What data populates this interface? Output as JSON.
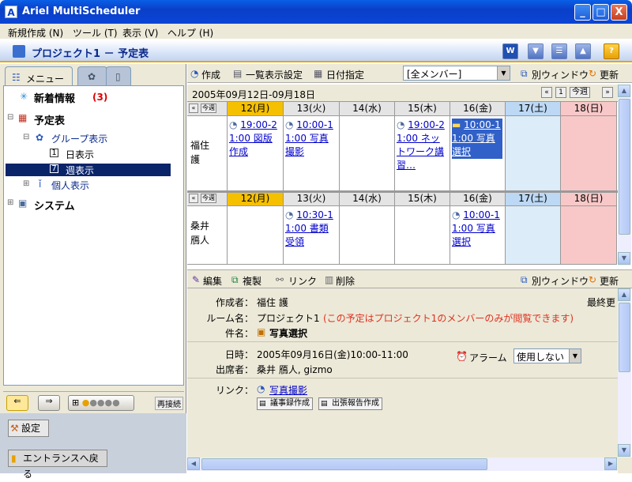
{
  "window": {
    "title": "Ariel MultiScheduler",
    "app_icon": "A",
    "minimize": "_",
    "maximize": "□",
    "close": "X"
  },
  "menu": [
    "新規作成 (N)",
    "ツール (T)",
    "表示 (V)",
    "ヘルプ (H)"
  ],
  "project": {
    "title": "プロジェクト1 － 予定表"
  },
  "left": {
    "tab_menu": "メニュー",
    "tree": {
      "news": "新着情報",
      "news_count": "(3)",
      "schedule": "予定表",
      "group_view": "グループ表示",
      "day_view": "日表示",
      "week_view": "週表示",
      "personal_view": "個人表示",
      "system": "システム"
    },
    "reconnect": "再接続",
    "settings": "設定",
    "back_entrance": "エントランスへ戻る"
  },
  "toolbar": {
    "create": "作成",
    "list_settings": "一覧表示設定",
    "date_pick": "日付指定",
    "member_select": "[全メンバー]",
    "separate_window": "別ウィンドウ",
    "refresh": "更新"
  },
  "calendar": {
    "range": "2005年09月12日-09月18日",
    "this_week": "今週",
    "days": [
      "12(月)",
      "13(火)",
      "14(水)",
      "15(木)",
      "16(金)",
      "17(土)",
      "18(日)"
    ],
    "rows": [
      {
        "person": "福住\n護",
        "events": [
          {
            "day": 0,
            "time": "19:00-21:00",
            "title": "図版作成"
          },
          {
            "day": 1,
            "time": "10:00-11:00",
            "title": "写真撮影"
          },
          {
            "day": 3,
            "time": "19:00-21:00",
            "title": "ネットワーク講習…"
          },
          {
            "day": 4,
            "time": "10:00-11:00",
            "title": "写真選択",
            "selected": true
          }
        ]
      },
      {
        "person": "桑井\n鴈人",
        "events": [
          {
            "day": 1,
            "time": "10:30-11:00",
            "title": "書類受領"
          },
          {
            "day": 4,
            "time": "10:00-11:00",
            "title": "写真選択"
          }
        ]
      }
    ]
  },
  "detail_toolbar": {
    "edit": "編集",
    "copy": "複製",
    "link": "リンク",
    "delete": "削除",
    "separate_window": "別ウィンドウ",
    "refresh": "更新"
  },
  "detail": {
    "author_label": "作成者：",
    "author": "福住 護",
    "last_label": "最終更",
    "room_label": "ルーム名：",
    "room": "プロジェクト1",
    "room_note": "(この予定はプロジェクト1のメンバーのみが閲覧できます)",
    "subject_label": "件名：",
    "subject": "写真選択",
    "datetime_label": "日時：",
    "datetime": "2005年09月16日(金)10:00-11:00",
    "attendees_label": "出席者：",
    "attendees": "桑井 鴈人, gizmo",
    "alarm_label": "アラーム",
    "alarm_value": "使用しない",
    "link_label": "リンク：",
    "link": "写真撮影",
    "minutes_btn": "議事録作成",
    "report_btn": "出張報告作成"
  },
  "colors": {
    "today": "#f5c000",
    "saturday": "#dcecf8",
    "sunday": "#f8c8c8",
    "accent": "#0a246a"
  }
}
